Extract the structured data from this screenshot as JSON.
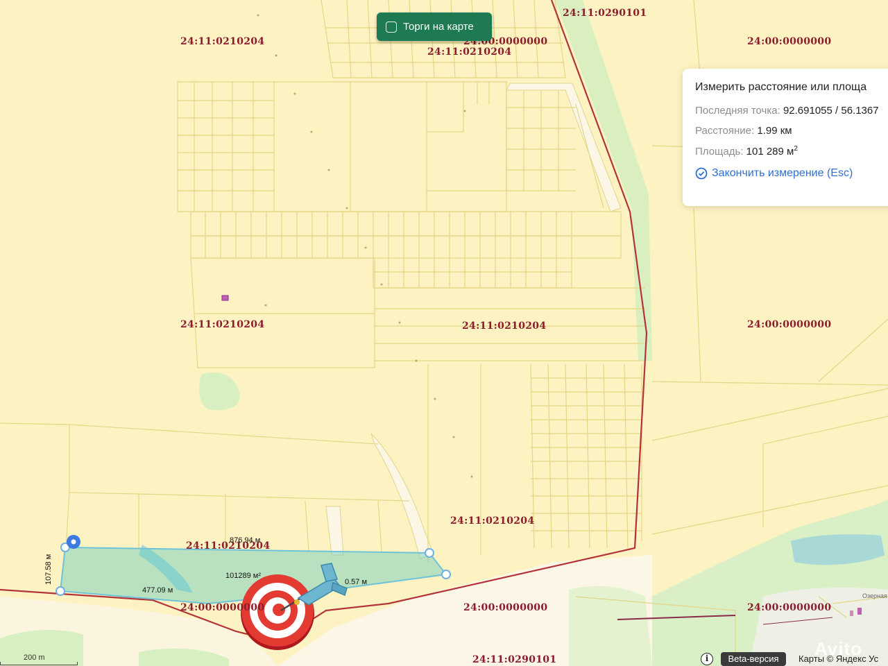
{
  "auction_toggle": {
    "label": "Торги на карте",
    "checked": false
  },
  "measure_panel": {
    "title": "Измерить расстояние или площа",
    "last_point_label": "Последняя точка:",
    "last_point_value": "92.691055 / 56.1367",
    "distance_label": "Расстояние:",
    "distance_value": "1.99 км",
    "area_label": "Площадь:",
    "area_value": "101 289 м",
    "area_unit_sup": "2",
    "finish_label": "Закончить измерение (Esc)"
  },
  "cadastral_labels": [
    "24:11:0290101",
    "24:11:0210204",
    "24:00:0000000",
    "24:11:0210204",
    "24:00:0000000",
    "24:11:0210204",
    "24:11:0210204",
    "24:00:0000000",
    "24:11:0210204",
    "24:11:0210204",
    "24:00:0000000",
    "24:00:0000000",
    "24:00:0000000",
    "24:11:0290101"
  ],
  "measurements": {
    "top_edge": "876.94 м",
    "left_edge": "107.58 м",
    "bottom_edge": "477.09 м",
    "right_edge": "0.57 м",
    "area": "101289 м²"
  },
  "map_place_label": "Озерная",
  "scale_label": "200 m",
  "beta_label": "Beta-версия",
  "copyright": "Карты © Яндекс  Ус",
  "info_glyph": "i",
  "watermark": "Avito",
  "colors": {
    "map_bg": "#fdf3c2",
    "parcel_line": "#e2d686",
    "boundary": "#b3333a",
    "measure": "#6fc3d9",
    "button": "#1e7a52",
    "link": "#2f6fd0"
  }
}
